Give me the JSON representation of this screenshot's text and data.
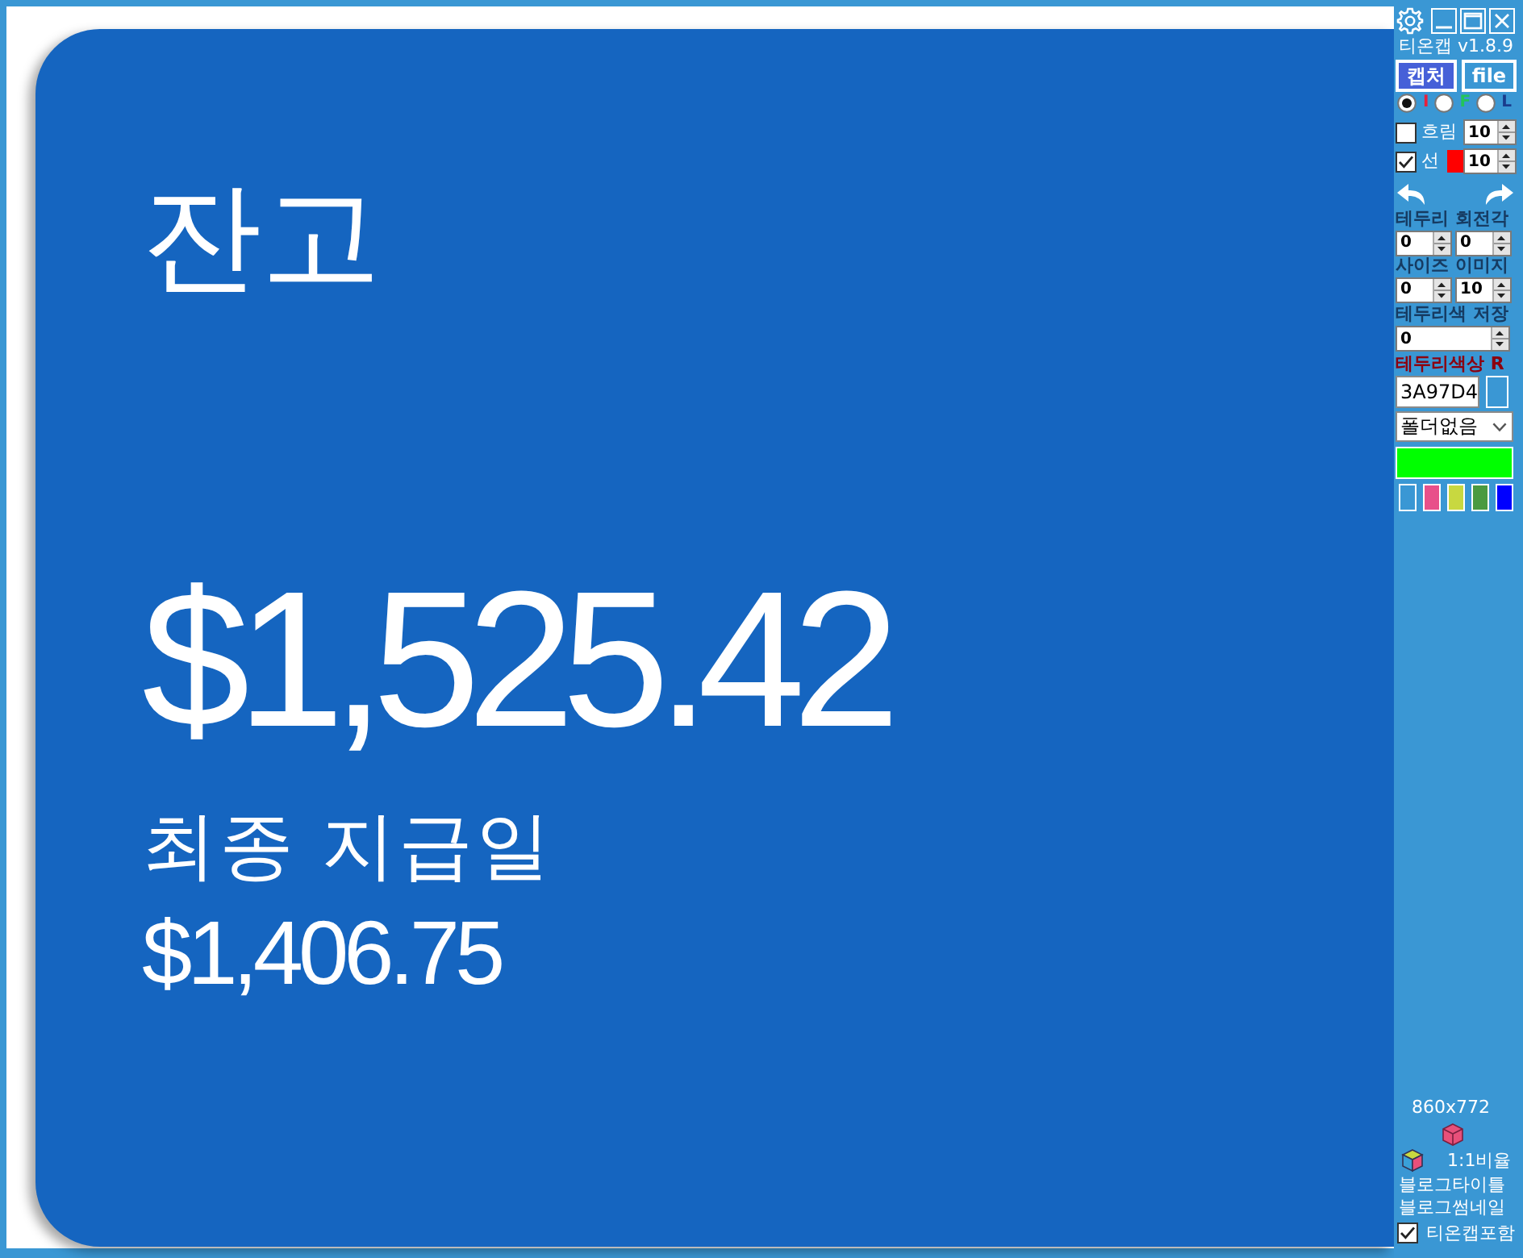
{
  "card": {
    "title": "잔고",
    "balance": "$1,525.42",
    "last_payment_label": "최종 지급일",
    "last_payment_amount": "$1,406.75"
  },
  "sidebar": {
    "app_title": "티온캡 v1.8.9",
    "buttons": [
      {
        "label": "캡처",
        "selected": true
      },
      {
        "label": "file",
        "selected": false
      }
    ],
    "modes": [
      {
        "label": "I",
        "selected": true,
        "color": "#e8203c"
      },
      {
        "label": "F",
        "selected": false,
        "color": "#22c45a"
      },
      {
        "label": "L",
        "selected": false,
        "color": "#1a3c8c"
      }
    ],
    "blur": {
      "label": "흐림",
      "checked": false,
      "value": "10"
    },
    "line": {
      "label": "선",
      "checked": true,
      "value": "10"
    },
    "rotation": {
      "label": "테두리 회전각",
      "values": [
        "0",
        "0"
      ]
    },
    "size": {
      "label": "사이즈 이미지",
      "values": [
        "0",
        "10"
      ]
    },
    "border_save": {
      "label": "테두리색 저장",
      "value": "0"
    },
    "border_color": {
      "label": "테두리색상 R",
      "hex": "3A97D4"
    },
    "folder": {
      "value": "폴더없음"
    },
    "swatches": [
      {
        "color": "#3a97d4"
      },
      {
        "color": "#e8508a"
      },
      {
        "color": "#c8d840"
      },
      {
        "color": "#4a9a40"
      },
      {
        "color": "#0000ff"
      }
    ],
    "dimensions": "860x772",
    "ratio_label": "1:1비율",
    "links": [
      "블로그타이틀",
      "블로그썸네일"
    ],
    "include": {
      "label": "티온캡포함",
      "checked": true
    }
  }
}
